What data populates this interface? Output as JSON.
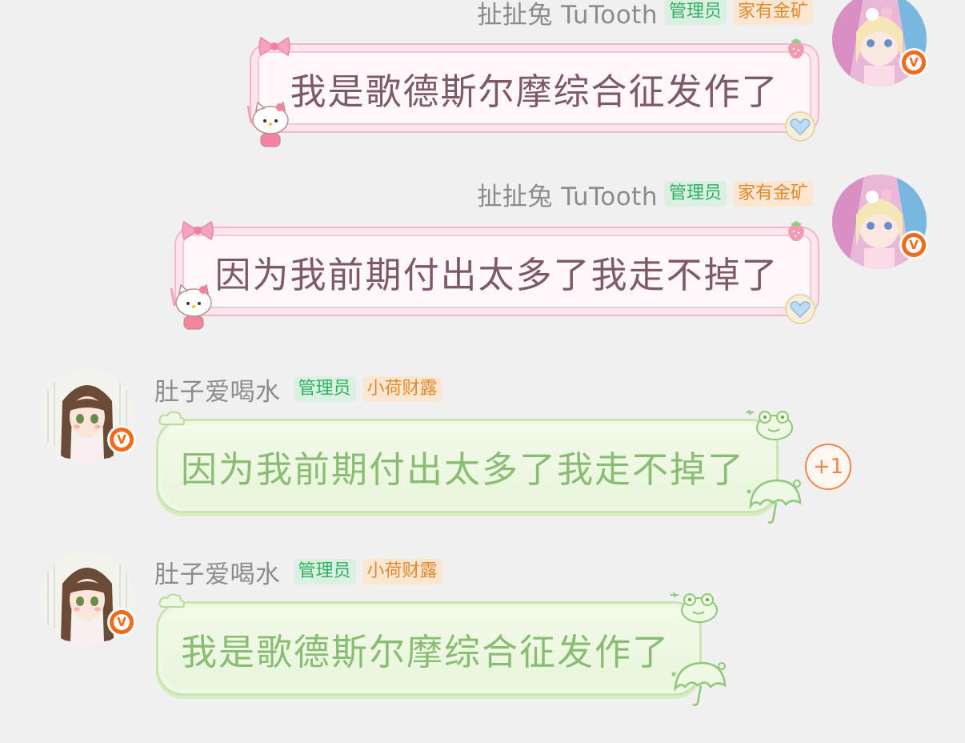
{
  "messages": [
    {
      "side": "right",
      "sender": "扯扯兔 TuTooth",
      "tags": [
        "管理员",
        "家有金矿"
      ],
      "text": "我是歌德斯尔摩综合征发作了"
    },
    {
      "side": "right",
      "sender": "扯扯兔 TuTooth",
      "tags": [
        "管理员",
        "家有金矿"
      ],
      "text": "因为我前期付出太多了我走不掉了"
    },
    {
      "side": "left",
      "sender": "肚子爱喝水",
      "tags": [
        "管理员",
        "小荷财露"
      ],
      "text": "因为我前期付出太多了我走不掉了",
      "reaction": "+1"
    },
    {
      "side": "left",
      "sender": "肚子爱喝水",
      "tags": [
        "管理员",
        "小荷财露"
      ],
      "text": "我是歌德斯尔摩综合征发作了"
    }
  ],
  "badge": {
    "glyph": "V",
    "color": "#f26a1b"
  },
  "colors": {
    "background": "#f0f0f0",
    "admin_tag_text": "#2eb25f",
    "gold_tag_text": "#e08a2c",
    "pink_bubble_text": "#7e5a67",
    "green_bubble_text": "#8abd74"
  },
  "icons": {
    "pink_bubble": [
      "bow-icon",
      "strawberry-icon",
      "kitty-icon",
      "heart-charm-icon"
    ],
    "green_bubble": [
      "frog-icon",
      "umbrella-icon",
      "sparkle-icon"
    ]
  }
}
